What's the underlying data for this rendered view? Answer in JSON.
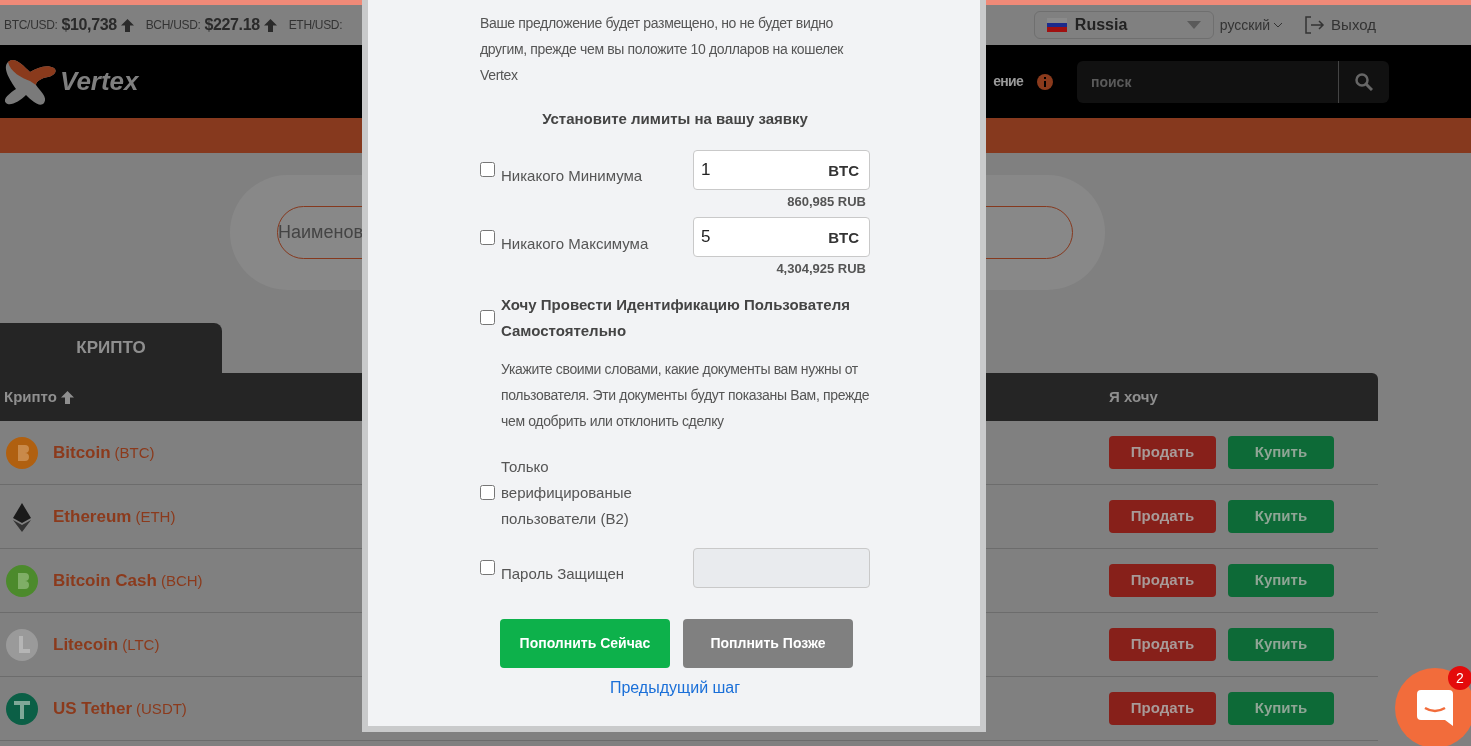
{
  "ticker": [
    {
      "pair": "BTC/USD:",
      "price": "$10,738"
    },
    {
      "pair": "BCH/USD:",
      "price": "$227.18"
    },
    {
      "pair": "ETH/USD:"
    }
  ],
  "country_select": {
    "value": "Russia"
  },
  "language": "русский",
  "logout": "Выход",
  "logo": "Vertex",
  "nav_item": "ение",
  "search": {
    "placeholder": "поиск"
  },
  "name_search": {
    "placeholder": "Наименов"
  },
  "tabs": [
    {
      "label": "КРИПТО",
      "selected": true
    }
  ],
  "table": {
    "columns": [
      "Крипто",
      "Я хочу"
    ],
    "rows": [
      {
        "kind": "btc",
        "name": "Bitcoin",
        "symbol": "(BTC)",
        "sell": "Продать",
        "buy": "Купить"
      },
      {
        "kind": "eth",
        "name": "Ethereum",
        "symbol": "(ETH)",
        "sell": "Продать",
        "buy": "Купить"
      },
      {
        "kind": "bch",
        "name": "Bitcoin Cash",
        "symbol": "(BCH)",
        "sell": "Продать",
        "buy": "Купить"
      },
      {
        "kind": "ltc",
        "name": "Litecoin",
        "symbol": "(LTC)",
        "sell": "Продать",
        "buy": "Купить"
      },
      {
        "kind": "usdt",
        "name": "US Tether",
        "symbol": "(USDT)",
        "sell": "Продать",
        "buy": "Купить"
      }
    ]
  },
  "modal": {
    "intro": "Ваше предложение будет размещено, но не будет видно другим, прежде чем вы положите 10 долларов на кошелек Vertex",
    "limits_title": "Установите лимиты на вашу заявку",
    "limits": [
      {
        "label": "Никакого Минимума",
        "checked": false,
        "value": "1",
        "unit": "BTC",
        "converted": "860,985 RUB"
      },
      {
        "label": "Никакого Максимума",
        "checked": false,
        "value": "5",
        "unit": "BTC",
        "converted": "4,304,925 RUB"
      }
    ],
    "options": [
      {
        "kind": "identification",
        "label": "Хочу Провести Идентификацию Пользователя Самостоятельно",
        "checked": false,
        "description": "Укажите своими словами, какие документы вам нужны от пользователя. Эти документы будут показаны Вам, прежде чем одобрить или отклонить сделку"
      },
      {
        "kind": "verified",
        "label": "Только верифицированые пользователи (B2)",
        "checked": false
      },
      {
        "kind": "password",
        "label": "Пароль Защищен",
        "checked": false
      }
    ],
    "buttons": [
      {
        "kind": "primary",
        "label": "Пополнить Сейчас"
      },
      {
        "kind": "secondary",
        "label": "Поплнить Позже"
      }
    ],
    "back_link": "Предыдущий шаг"
  },
  "chat": {
    "badge": "2"
  }
}
